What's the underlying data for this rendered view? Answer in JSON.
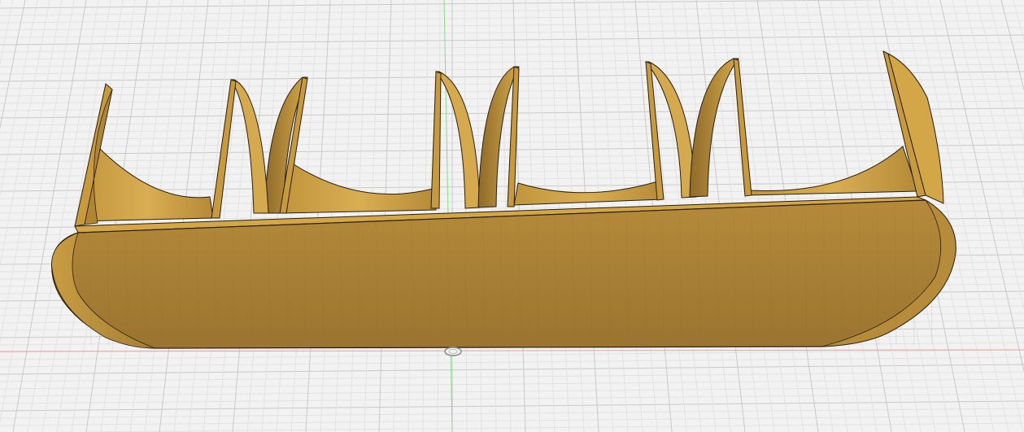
{
  "colors": {
    "background": "#f2f2f2",
    "grid_minor": "#e2e2e2",
    "grid_major": "#c9c9c9",
    "axis_x": "#e8a0a0",
    "axis_y": "#8ad88a",
    "body_face": "#a8823a",
    "body_side": "#c79a3e",
    "body_top": "#d3a748",
    "body_dark": "#7a5a20",
    "outline": "#2a1f0f",
    "divider_shade": "#9c7530"
  },
  "scene": {
    "model": "holder-body",
    "divider_count": 4,
    "end_wall_count": 2,
    "cradle_count": 4,
    "origin_marker": "origin-icon"
  }
}
